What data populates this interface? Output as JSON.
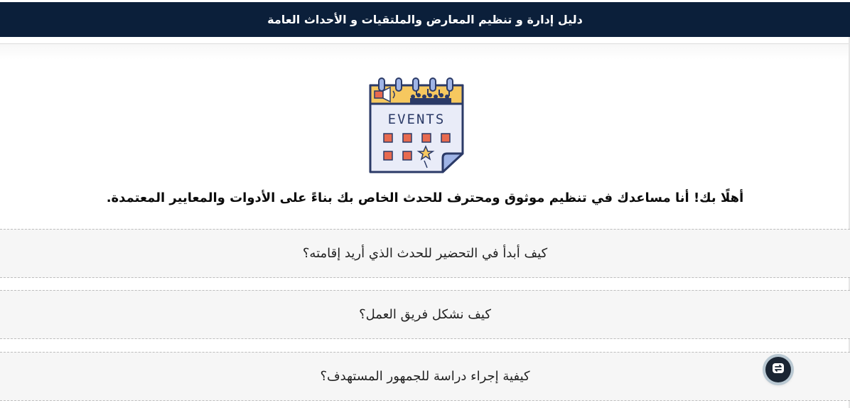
{
  "header": {
    "title": "دليل إدارة و تنظيم المعارض والملتقيات و الأحداث العامة"
  },
  "logo": {
    "icon": "events-calendar-icon",
    "text": "EVENTS"
  },
  "greeting": {
    "text": "أهلًا بك! أنا مساعدك في تنظيم موثوق ومحترف للحدث الخاص بك بناءً على الأدوات والمعايير المعتمدة."
  },
  "faq": {
    "items": [
      {
        "label": "كيف أبدأ في التحضير للحدث الذي أريد إقامته؟"
      },
      {
        "label": "كيف نشكل فريق العمل؟"
      },
      {
        "label": "كيفية إجراء دراسة للجمهور المستهدف؟"
      }
    ]
  },
  "fab": {
    "icon": "chat-assistant-icon"
  },
  "colors": {
    "header_bg": "#0b1f3a",
    "faq_bg": "#f6f6f6",
    "calendar_top": "#f6c85f",
    "calendar_body": "#e9ecf8",
    "calendar_outline": "#2b3a67",
    "square_fill": "#e86a4f",
    "fab_bg": "#1a2533"
  }
}
